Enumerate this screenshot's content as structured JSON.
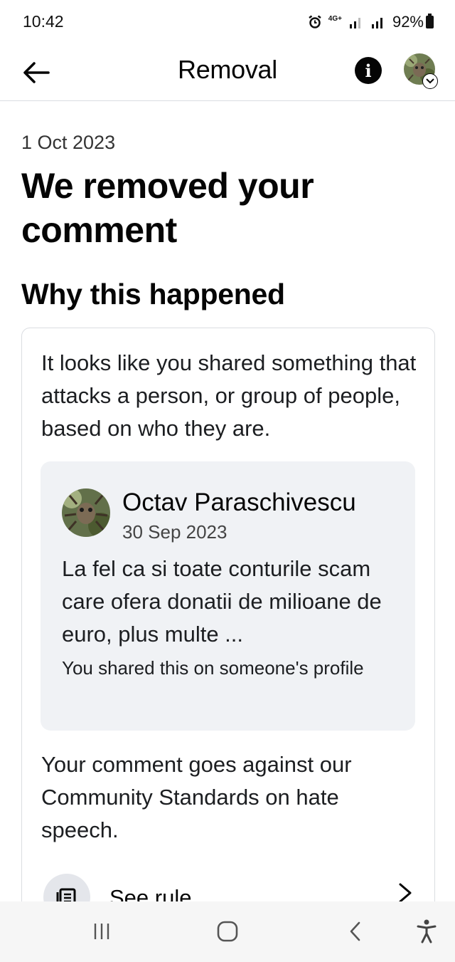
{
  "status_bar": {
    "time": "10:42",
    "network": "4G+",
    "battery": "92%"
  },
  "header": {
    "title": "Removal",
    "icons": {
      "back": "arrow-left-icon",
      "info": "info-icon",
      "avatar_menu": "chevron-down-icon"
    }
  },
  "notice": {
    "date": "1 Oct 2023",
    "headline": "We removed your comment",
    "section_heading": "Why this happened",
    "reason": "It looks like you shared something that attacks a person, or group of people, based on who they are.",
    "comment": {
      "author": "Octav Paraschivescu",
      "date": "30 Sep 2023",
      "text": "La fel ca si toate conturile scam care ofera donatii de milioane de euro, plus multe ...",
      "shared_note": "You shared this on someone's profile"
    },
    "standards": "Your comment goes against our Community Standards on hate speech.",
    "see_rule_label": "See rule"
  },
  "colors": {
    "text_primary": "#050505",
    "card_border": "#dadde1",
    "comment_bg": "#f0f2f5",
    "nav_bg": "#f6f6f6"
  }
}
